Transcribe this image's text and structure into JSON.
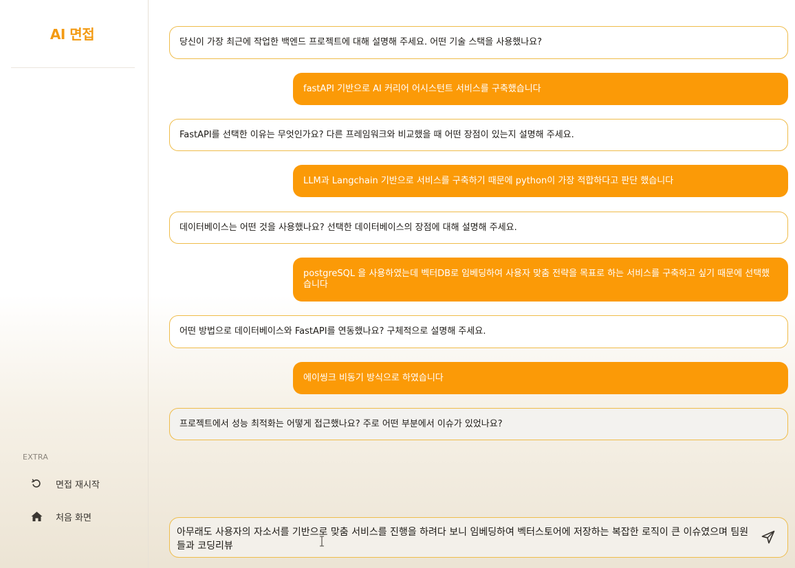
{
  "app": {
    "title": "AI 면접"
  },
  "sidebar": {
    "section_label": "EXTRA",
    "items": [
      {
        "label": "면접 재시작",
        "icon": "restart-icon"
      },
      {
        "label": "처음 화면",
        "icon": "home-icon"
      }
    ]
  },
  "messages": [
    {
      "role": "question",
      "text": "당신이 가장 최근에 작업한 백엔드 프로젝트에 대해 설명해 주세요. 어떤 기술 스택을 사용했나요?"
    },
    {
      "role": "answer",
      "text": "fastAPI 기반으로 AI 커리어 어시스턴트 서비스를 구축했습니다"
    },
    {
      "role": "question",
      "text": "FastAPI를 선택한 이유는 무엇인가요? 다른 프레임워크와 비교했을 때 어떤 장점이 있는지 설명해 주세요."
    },
    {
      "role": "answer",
      "text": "LLM과 Langchain 기반으로 서비스를 구축하기 때문에 python이 가장 적합하다고 판단 했습니다"
    },
    {
      "role": "question",
      "text": "데이터베이스는 어떤 것을 사용했나요? 선택한 데이터베이스의 장점에 대해 설명해 주세요."
    },
    {
      "role": "answer",
      "text": "postgreSQL 을 사용하였는데 벡터DB로 임베딩하여 사용자 맞춤 전략을 목표로 하는 서비스를 구축하고 싶기 때문에 선택했습니다"
    },
    {
      "role": "question",
      "text": "어떤 방법으로 데이터베이스와 FastAPI를 연동했나요? 구체적으로 설명해 주세요."
    },
    {
      "role": "answer",
      "text": "에이씽크 비동기 방식으로 하였습니다"
    },
    {
      "role": "question",
      "text": "프로젝트에서 성능 최적화는 어떻게 접근했나요? 주로 어떤 부분에서 이슈가 있었나요?"
    }
  ],
  "composer": {
    "value": "아무래도 사용자의 자소서를 기반으로 맞춤 서비스를 진행을 하려다 보니 임베딩하여 벡터스토어에 저장하는 복잡한 로직이 큰 이슈였으며 팀원들과 코딩리뷰",
    "send_icon": "send-icon"
  },
  "colors": {
    "accent": "#fb9a07",
    "brand": "#f39a12",
    "question_border": "#efbc4a"
  }
}
